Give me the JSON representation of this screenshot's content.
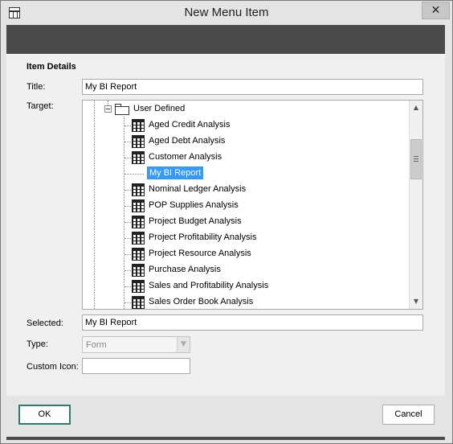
{
  "window": {
    "title": "New Menu Item",
    "close_label": "✕"
  },
  "form": {
    "section_title": "Item Details",
    "title_label": "Title:",
    "title_value": "My BI Report",
    "target_label": "Target:",
    "selected_label": "Selected:",
    "selected_value": "My BI Report",
    "type_label": "Type:",
    "type_value": "Form",
    "custom_icon_label": "Custom Icon:",
    "custom_icon_value": ""
  },
  "tree": {
    "root": {
      "label": "User Defined",
      "icon": "folder-icon",
      "expanded": true
    },
    "items": [
      {
        "label": "Aged Credit Analysis",
        "icon": "grid-icon"
      },
      {
        "label": "Aged Debt Analysis",
        "icon": "grid-icon"
      },
      {
        "label": "Customer Analysis",
        "icon": "grid-icon"
      },
      {
        "label": "My BI Report",
        "icon": "",
        "selected": true
      },
      {
        "label": "Nominal Ledger Analysis",
        "icon": "grid-icon"
      },
      {
        "label": "POP Supplies Analysis",
        "icon": "grid-icon"
      },
      {
        "label": "Project Budget Analysis",
        "icon": "grid-icon"
      },
      {
        "label": "Project Profitability Analysis",
        "icon": "grid-icon"
      },
      {
        "label": "Project Resource Analysis",
        "icon": "grid-icon"
      },
      {
        "label": "Purchase Analysis",
        "icon": "grid-icon"
      },
      {
        "label": "Sales and Profitability Analysis",
        "icon": "grid-icon"
      },
      {
        "label": "Sales Order Book Analysis",
        "icon": "grid-icon"
      }
    ],
    "selection_color": "#3399ff"
  },
  "buttons": {
    "ok_label": "OK",
    "cancel_label": "Cancel"
  },
  "colors": {
    "default_button_border": "#2d7d6c",
    "dark_bar": "#4b4b4b"
  }
}
